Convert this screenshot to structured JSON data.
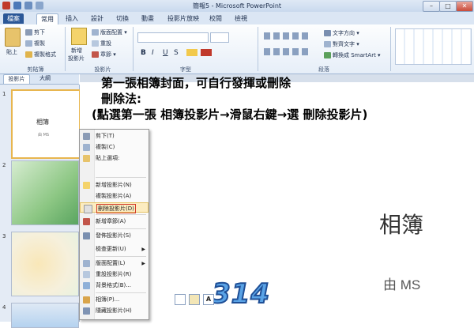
{
  "window": {
    "title": "簡報5 - Microsoft PowerPoint",
    "buttons": [
      "–",
      "□",
      "✕"
    ]
  },
  "tabs": [
    {
      "label": "檔案"
    },
    {
      "label": "常用"
    },
    {
      "label": "插入"
    },
    {
      "label": "設計"
    },
    {
      "label": "切換"
    },
    {
      "label": "動畫"
    },
    {
      "label": "投影片放映"
    },
    {
      "label": "校閱"
    },
    {
      "label": "檢視"
    }
  ],
  "ribbon": {
    "clipboard": {
      "paste": "貼上",
      "cut": "剪下",
      "copy": "複製",
      "format_painter": "複製格式",
      "group": "剪貼簿"
    },
    "slides": {
      "new_slide": "新增",
      "new_slide_2": "投影片",
      "layout": "版面配置",
      "reset": "重設",
      "section": "章節",
      "group": "投影片"
    },
    "font": {
      "bold": "B",
      "italic": "I",
      "underline": "U",
      "strike": "S",
      "group": "字型"
    },
    "paragraph": {
      "text_direction": "文字方向",
      "align_text": "對齊文字",
      "smartart": "轉換成 SmartArt",
      "group": "段落"
    }
  },
  "panel_tabs": {
    "slides": "投影片",
    "outline": "大綱"
  },
  "thumbnails": [
    {
      "num": "1",
      "title": "相簿",
      "by": "由 MS"
    },
    {
      "num": "2"
    },
    {
      "num": "3"
    },
    {
      "num": "4"
    }
  ],
  "annotation": {
    "line1": "第一張相簿封面，可自行發揮或刪除",
    "line2": "刪除法:",
    "line3": "(點選第一張 相簿投影片→滑鼠右鍵→選 刪除投影片)"
  },
  "context_menu": {
    "items": [
      {
        "label": "剪下(T)"
      },
      {
        "label": "複製(C)"
      },
      {
        "label": "貼上選項:"
      },
      {
        "label": "新增投影片(N)"
      },
      {
        "label": "複製投影片(A)"
      },
      {
        "label": "刪除投影片(D)",
        "highlight": true
      },
      {
        "label": "新增章節(A)"
      },
      {
        "label": "發佈投影片(S)"
      },
      {
        "label": "檢查更新(U)",
        "submenu": true
      },
      {
        "label": "版面配置(L)",
        "submenu": true
      },
      {
        "label": "重設投影片(R)"
      },
      {
        "label": "背景格式(B)..."
      },
      {
        "label": "相簿(P)..."
      },
      {
        "label": "隱藏投影片(H)"
      }
    ],
    "paste_options": [
      "",
      "",
      "A"
    ],
    "highlight_color": "#fcecc0"
  },
  "slide": {
    "title": "相簿",
    "byline": "由 MS",
    "watermark": "314"
  },
  "colors": {
    "file_tab": "#2b5797",
    "ribbon_bg": "#e6eef8"
  }
}
